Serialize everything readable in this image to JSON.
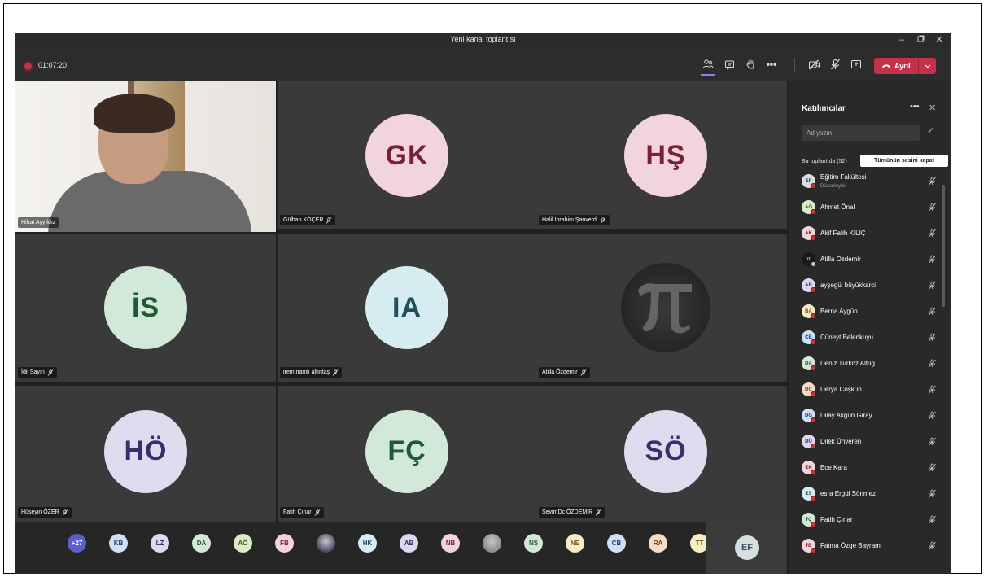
{
  "window": {
    "title": "Yeni kanal toplantısı"
  },
  "toolbar": {
    "timer": "01:07:20",
    "leave_label": "Ayrıl"
  },
  "tiles": [
    {
      "name": "Nihat Ayyıldız",
      "type": "video",
      "muted": false
    },
    {
      "name": "Gülhan KÖÇER",
      "initials": "GK",
      "bg": "#f2d4dc",
      "fg": "#7a1f3a",
      "muted": true
    },
    {
      "name": "Halil İbrahim Şanverdi",
      "initials": "HŞ",
      "bg": "#f2d4dc",
      "fg": "#7a1f3a",
      "muted": true
    },
    {
      "name": "İdil Sayın",
      "initials": "İS",
      "bg": "#d2e8d8",
      "fg": "#1f5a32",
      "muted": true
    },
    {
      "name": "irem namlı altıntaş",
      "initials": "IA",
      "bg": "#d5ecf0",
      "fg": "#1f4f5a",
      "muted": true
    },
    {
      "name": "Atilla Özdemir",
      "type": "pi-image",
      "muted": true
    },
    {
      "name": "Hüseyin ÖZER",
      "initials": "HÖ",
      "bg": "#e0dcf0",
      "fg": "#3a2f6b",
      "muted": true
    },
    {
      "name": "Fatih Çınar",
      "initials": "FÇ",
      "bg": "#d2e8d8",
      "fg": "#1f5a32",
      "muted": true
    },
    {
      "name": "SevimDc ÖZDEMİR",
      "initials": "SÖ",
      "bg": "#e0dcf0",
      "fg": "#3a2f6b",
      "muted": true
    }
  ],
  "strip": {
    "avatars": [
      {
        "initials": "+27",
        "bg": "#5b5fc7",
        "fg": "#ffffff"
      },
      {
        "initials": "KB",
        "bg": "#cfe0f5",
        "fg": "#1f3f6b"
      },
      {
        "initials": "LZ",
        "bg": "#dcd8f0",
        "fg": "#3a2f6b"
      },
      {
        "initials": "DA",
        "bg": "#d2e8d8",
        "fg": "#1f5a32"
      },
      {
        "initials": "AÖ",
        "bg": "#dcecc8",
        "fg": "#3f5a1f"
      },
      {
        "initials": "FB",
        "bg": "#f2d4dc",
        "fg": "#7a1f3a"
      },
      {
        "initials": "",
        "bg": "#4a4a6a",
        "fg": "#ffffff",
        "photo": true
      },
      {
        "initials": "HK",
        "bg": "#d5ecf0",
        "fg": "#1f4f5a"
      },
      {
        "initials": "AB",
        "bg": "#dcd8f0",
        "fg": "#3a2f6b"
      },
      {
        "initials": "NB",
        "bg": "#f2d4dc",
        "fg": "#7a1f3a"
      },
      {
        "initials": "",
        "bg": "#8a8a8a",
        "fg": "#ffffff",
        "photo": true
      },
      {
        "initials": "NŞ",
        "bg": "#d2e8d8",
        "fg": "#1f5a32"
      },
      {
        "initials": "NE",
        "bg": "#f7ecc4",
        "fg": "#6b531f"
      },
      {
        "initials": "CB",
        "bg": "#cfe0f5",
        "fg": "#1f3f6b"
      },
      {
        "initials": "RA",
        "bg": "#f8ddc6",
        "fg": "#7a3f1f"
      },
      {
        "initials": "TT",
        "bg": "#f7ecc4",
        "fg": "#6b531f"
      }
    ],
    "self_initials": "EF"
  },
  "panel": {
    "title": "Katılımcılar",
    "search_placeholder": "Ad yazın",
    "in_meeting": "Bu toplantıda (52)",
    "mute_all": "Tümünün sesini kapat",
    "participants": [
      {
        "initials": "EF",
        "name": "Eğitim Fakültesi",
        "sub": "Düzenleyici",
        "bg": "#d6dee2",
        "fg": "#384a58",
        "dot": "red"
      },
      {
        "initials": "AÖ",
        "name": "Ahmet Önal",
        "bg": "#dcecc8",
        "fg": "#3f5a1f",
        "dot": "red"
      },
      {
        "initials": "AK",
        "name": "Akif Fatih KILIÇ",
        "bg": "#f2d4dc",
        "fg": "#7a1f3a",
        "dot": "red"
      },
      {
        "initials": "π",
        "name": "Atilla Özdemir",
        "bg": "#1a1a1a",
        "fg": "#bbbbbb",
        "dot": "ok"
      },
      {
        "initials": "AB",
        "name": "ayşegül büyükkarci",
        "bg": "#dcd8f0",
        "fg": "#3a2f6b",
        "dot": "red"
      },
      {
        "initials": "BA",
        "name": "Berna Aygün",
        "bg": "#f7ecc4",
        "fg": "#6b531f",
        "dot": "red"
      },
      {
        "initials": "CB",
        "name": "Cüneyt Belenkuyu",
        "bg": "#cfe0f5",
        "fg": "#1f3f6b",
        "dot": "red"
      },
      {
        "initials": "DA",
        "name": "Deniz Türköz Altuğ",
        "bg": "#d2e8d8",
        "fg": "#1f5a32",
        "dot": "red"
      },
      {
        "initials": "DC",
        "name": "Derya Coşkun",
        "bg": "#f8ddc6",
        "fg": "#7a3f1f",
        "dot": "red"
      },
      {
        "initials": "DG",
        "name": "Dilay Akgün Giray",
        "bg": "#cfe0f5",
        "fg": "#1f3f6b",
        "dot": "red"
      },
      {
        "initials": "DÜ",
        "name": "Dilek Ünveren",
        "bg": "#dcd8f0",
        "fg": "#3a2f6b",
        "dot": "red"
      },
      {
        "initials": "EK",
        "name": "Ece Kara",
        "bg": "#f2d4dc",
        "fg": "#7a1f3a",
        "dot": "red"
      },
      {
        "initials": "ES",
        "name": "esra Ergül Sönmez",
        "bg": "#d5ecf0",
        "fg": "#1f4f5a",
        "dot": "red"
      },
      {
        "initials": "FÇ",
        "name": "Fatih Çınar",
        "bg": "#d2e8d8",
        "fg": "#1f5a32",
        "dot": "red"
      },
      {
        "initials": "FB",
        "name": "Fatma Özge Bayram",
        "bg": "#f2d4dc",
        "fg": "#7a1f3a",
        "dot": "red"
      }
    ]
  },
  "colors": {
    "accent": "#7f85f5",
    "leave": "#c4314b",
    "panel_bg": "#292929",
    "tile_bg": "#3a3a3a"
  }
}
